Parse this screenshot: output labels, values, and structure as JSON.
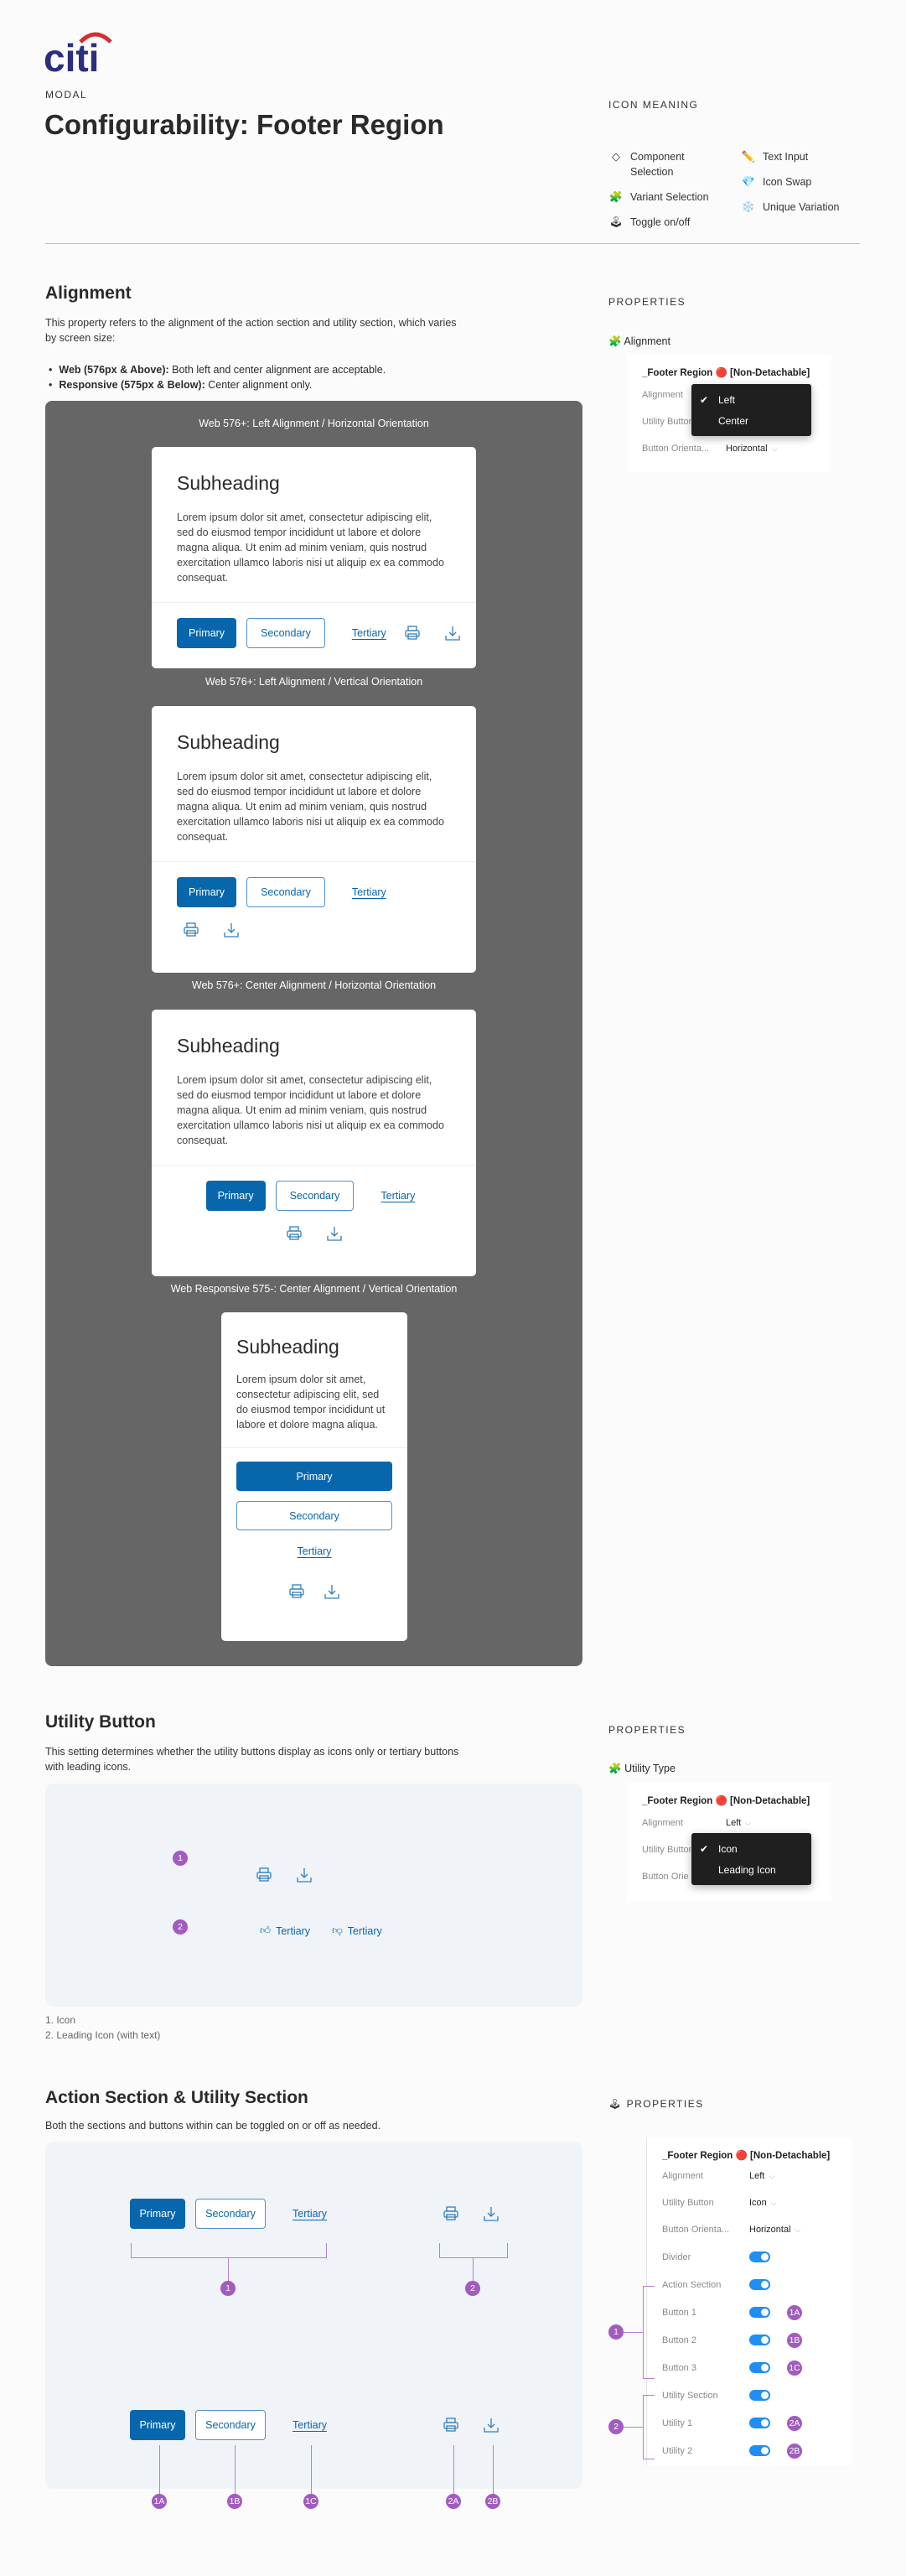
{
  "logo": {
    "text": "citi",
    "colors": {
      "arc": "#d42e2e",
      "text": "#2b2f7f"
    }
  },
  "header": {
    "eyebrow": "MODAL",
    "title": "Configurability: Footer Region"
  },
  "icon_meaning": {
    "title": "ICON MEANING",
    "items": [
      {
        "icon": "diamond-icon",
        "glyph": "◇",
        "label": "Component Selection"
      },
      {
        "icon": "puzzle-icon",
        "glyph": "🧩",
        "label": "Variant Selection"
      },
      {
        "icon": "joystick-icon",
        "glyph": "🕹",
        "label": "Toggle on/off"
      },
      {
        "icon": "pencil-icon",
        "glyph": "✏️",
        "label": "Text Input"
      },
      {
        "icon": "gem-icon",
        "glyph": "💎",
        "label": "Icon Swap"
      },
      {
        "icon": "snowflake-icon",
        "glyph": "❄️",
        "label": "Unique Variation"
      }
    ]
  },
  "alignment": {
    "title": "Alignment",
    "description": "This property refers to the alignment of the action section and utility section, which varies by screen size:",
    "bullets": [
      {
        "bold": "Web (576px & Above):",
        "text": " Both left and center alignment are acceptable."
      },
      {
        "bold": "Responsive (575px & Below):",
        "text": " Center alignment only."
      }
    ],
    "examples": [
      {
        "caption": "Web 576+: Left Alignment / Horizontal Orientation"
      },
      {
        "caption": "Web 576+: Left Alignment / Vertical Orientation"
      },
      {
        "caption": "Web 576+: Center Alignment / Horizontal Orientation"
      },
      {
        "caption": "Web Responsive 575-: Center Alignment / Vertical Orientation"
      }
    ],
    "card": {
      "subheading": "Subheading",
      "body": "Lorem ipsum dolor sit amet, consectetur adipiscing elit, sed do eiusmod tempor incididunt ut labore et dolore magna aliqua. Ut enim ad minim veniam, quis nostrud exercitation ullamco laboris nisi ut aliquip ex ea commodo consequat.",
      "body_short": "Lorem ipsum dolor sit amet, consectetur adipiscing elit, sed do eiusmod tempor incididunt ut labore et dolore magna aliqua.",
      "primary": "Primary",
      "secondary": "Secondary",
      "tertiary": "Tertiary"
    },
    "properties": {
      "title": "PROPERTIES",
      "group": "Alignment",
      "group_icon": "🧩",
      "component": "_Footer Region 🔴 [Non-Detachable]",
      "rows": [
        {
          "k": "Alignment",
          "v": ""
        },
        {
          "k": "Utility Button",
          "v": ""
        },
        {
          "k": "Button Orienta...",
          "v": "Horizontal"
        }
      ],
      "dropdown": {
        "options": [
          "Left",
          "Center"
        ],
        "selected": "Left"
      }
    }
  },
  "utility": {
    "title": "Utility Button",
    "description": "This setting determines whether the utility buttons display as icons only or tertiary buttons with leading icons.",
    "markers": [
      "1",
      "2"
    ],
    "leading": [
      {
        "icon": "thumbs-up-icon",
        "label": "Tertiary"
      },
      {
        "icon": "thumbs-down-icon",
        "label": "Tertiary"
      }
    ],
    "legend": [
      "1. Icon",
      "2. Leading Icon (with text)"
    ],
    "properties": {
      "title": "PROPERTIES",
      "group": "Utility Type",
      "group_icon": "🧩",
      "component": "_Footer Region 🔴 [Non-Detachable]",
      "rows": [
        {
          "k": "Alignment",
          "v": "Left"
        },
        {
          "k": "Utility Button",
          "v": ""
        },
        {
          "k": "Button Orie",
          "v": ""
        }
      ],
      "dropdown": {
        "options": [
          "Icon",
          "Leading Icon"
        ],
        "selected": "Icon"
      }
    }
  },
  "sections": {
    "title": "Action Section & Utility Section",
    "description": "Both the sections and buttons within can be toggled on or off as needed.",
    "group_markers": [
      "1",
      "2"
    ],
    "item_markers": [
      "1A",
      "1B",
      "1C",
      "2A",
      "2B"
    ],
    "properties": {
      "title": "PROPERTIES",
      "title_icon": "🕹",
      "component": "_Footer Region 🔴 [Non-Detachable]",
      "selects": [
        {
          "k": "Alignment",
          "v": "Left"
        },
        {
          "k": "Utility Button",
          "v": "Icon"
        },
        {
          "k": "Button Orienta...",
          "v": "Horizontal"
        }
      ],
      "toggles": [
        {
          "k": "Divider",
          "on": true,
          "marker": ""
        },
        {
          "k": "Action Section",
          "on": true,
          "marker": ""
        },
        {
          "k": "Button 1",
          "on": true,
          "marker": "1A"
        },
        {
          "k": "Button 2",
          "on": true,
          "marker": "1B"
        },
        {
          "k": "Button 3",
          "on": true,
          "marker": "1C"
        },
        {
          "k": "Utility Section",
          "on": true,
          "marker": ""
        },
        {
          "k": "Utility 1",
          "on": true,
          "marker": "2A"
        },
        {
          "k": "Utility 2",
          "on": true,
          "marker": "2B"
        }
      ],
      "bracket_markers": [
        "1",
        "2"
      ]
    }
  },
  "colors": {
    "primary": "#0766ac",
    "marker": "#a25bbe",
    "toggle": "#1e8ef5",
    "dark_panel": "#666666",
    "light_panel": "#f0f3f8"
  }
}
